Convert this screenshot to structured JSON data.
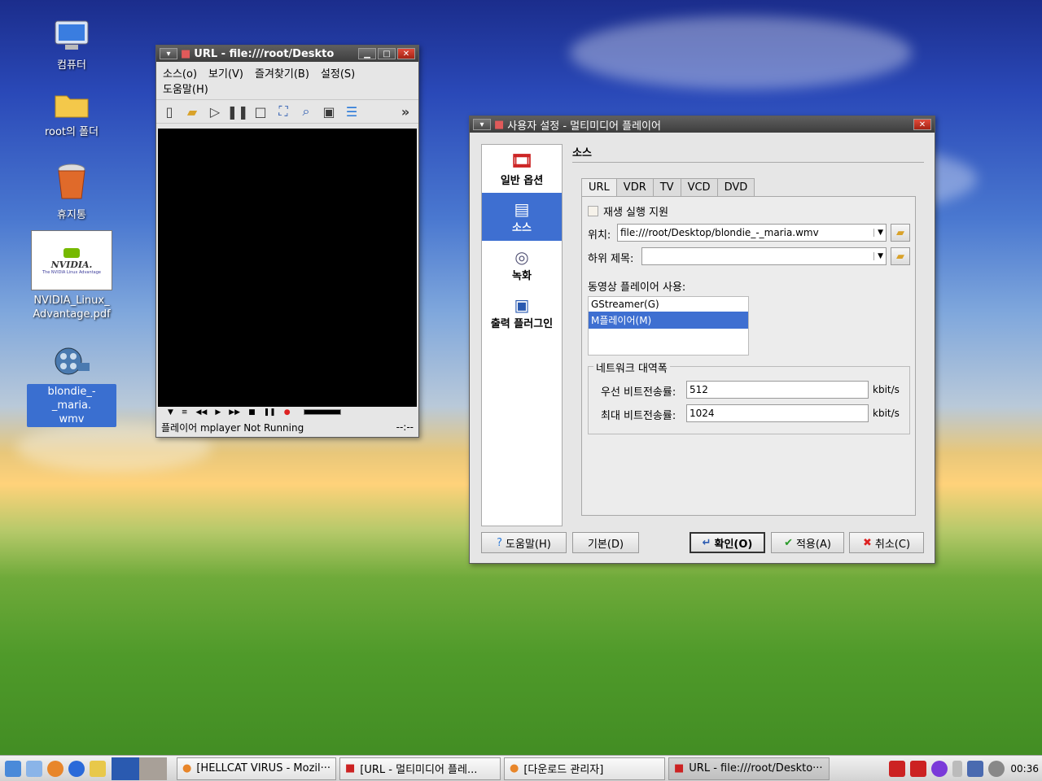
{
  "desktop": {
    "icons": [
      {
        "label": "컴퓨터"
      },
      {
        "label": "root의 폴더"
      },
      {
        "label": "휴지통"
      },
      {
        "label": "NVIDIA_Linux_\nAdvantage.pdf",
        "thumb_brand": "NVIDIA.",
        "thumb_sub": "The NVIDIA Linux Advantage"
      },
      {
        "label": "blondie_-_maria.\nwmv"
      }
    ]
  },
  "player": {
    "title": "URL - file:///root/Deskto",
    "menu": [
      "소스(o)",
      "보기(V)",
      "즐겨찾기(B)",
      "설정(S)",
      "도움말(H)"
    ],
    "toolbar_more": "»",
    "status_text": "플레이어 mplayer Not Running",
    "time": "--:--"
  },
  "dialog": {
    "title": "사용자 설정 - 멀티미디어 플레이어",
    "sidebar": [
      "일반 옵션",
      "소스",
      "녹화",
      "출력 플러그인"
    ],
    "section_title": "소스",
    "tabs": [
      "URL",
      "VDR",
      "TV",
      "VCD",
      "DVD"
    ],
    "playlist_checkbox": "재생 실행 지원",
    "location_label": "위치:",
    "location_value": "file:///root/Desktop/blondie_-_maria.wmv",
    "subtitle_label": "하위 제목:",
    "subtitle_value": "",
    "player_label": "동영상 플레이어 사용:",
    "players": [
      "GStreamer(G)",
      "M플레이어(M)"
    ],
    "network_group": "네트워크 대역폭",
    "pref_bitrate_label": "우선 비트전송률:",
    "pref_bitrate_value": "512",
    "max_bitrate_label": "최대 비트전송률:",
    "max_bitrate_value": "1024",
    "unit": "kbit/s",
    "buttons": {
      "help": "도움말(H)",
      "default": "기본(D)",
      "ok": "확인(O)",
      "apply": "적용(A)",
      "cancel": "취소(C)"
    }
  },
  "taskbar": {
    "tasks": [
      "[HELLCAT VIRUS - Mozil···",
      "[URL - 멀티미디어 플레...",
      "[다운로드 관리자]",
      "URL - file:///root/Deskto···"
    ],
    "clock": "00:36"
  }
}
